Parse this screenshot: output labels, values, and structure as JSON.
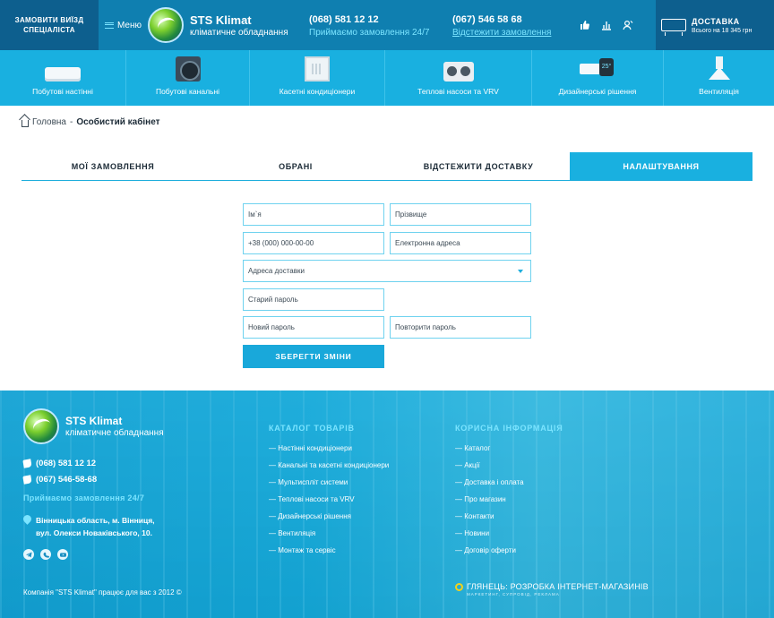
{
  "header": {
    "order_specialist": "ЗАМОВИТИ ВИЇЗД СПЕЦІАЛІСТА",
    "menu_label": "Меню",
    "brand_name": "STS Klimat",
    "brand_tagline": "кліматичне обладнання",
    "phone_1": "(068) 581 12 12",
    "phone_1_sub": "Приймаємо замовлення 24/7",
    "phone_2": "(067) 546 58 68",
    "phone_2_sub": "Відстежити замовлення",
    "icons": [
      "thumbs-up-icon",
      "chart-icon",
      "user-icon"
    ],
    "delivery_title": "ДОСТАВКА",
    "delivery_sub": "Всього на 18 345 грн"
  },
  "categories": [
    {
      "label": "Побутові настінні",
      "icon": "wall-ac-icon"
    },
    {
      "label": "Побутові канальні",
      "icon": "duct-ac-icon"
    },
    {
      "label": "Касетні кондиціонери",
      "icon": "cassette-ac-icon"
    },
    {
      "label": "Теплові насоси та VRV",
      "icon": "heat-pump-icon"
    },
    {
      "label": "Дизайнерські рішення",
      "icon": "designer-ac-icon",
      "badge": "25°"
    },
    {
      "label": "Вентиляція",
      "icon": "ventilation-icon"
    }
  ],
  "breadcrumb": {
    "home": "Головна",
    "separator": "-",
    "current": "Особистий кабінет"
  },
  "tabs": [
    {
      "label": "МОЇ ЗАМОВЛЕННЯ",
      "active": false
    },
    {
      "label": "ОБРАНІ",
      "active": false
    },
    {
      "label": "ВІДСТЕЖИТИ ДОСТАВКУ",
      "active": false
    },
    {
      "label": "НАЛАШТУВАННЯ",
      "active": true
    }
  ],
  "form": {
    "first_name_placeholder": "Ім`я",
    "last_name_placeholder": "Прізвище",
    "phone_placeholder": "+38 (000) 000-00-00",
    "email_placeholder": "Електронна адреса",
    "address_placeholder": "Адреса доставки",
    "old_password_placeholder": "Старий пароль",
    "new_password_placeholder": "Новий пароль",
    "repeat_password_placeholder": "Повторити пароль",
    "save_label": "ЗБЕРЕГТИ ЗМІНИ"
  },
  "footer": {
    "brand_name": "STS Klimat",
    "brand_tagline": "кліматичне обладнання",
    "phone_1": "(068) 581 12 12",
    "phone_2": "(067) 546-58-68",
    "accept_text": "Приймаємо замовлення 24/7",
    "address_line_1": "Вінницька область, м. Вінниця,",
    "address_line_2": "вул. Олекси Новаківського, 10.",
    "socials": [
      "telegram-icon",
      "viber-icon",
      "youtube-icon"
    ],
    "catalog_title": "КАТАЛОГ ТОВАРІВ",
    "catalog_items": [
      "— Настінні кондиціонери",
      "— Канальні та касетні кондиціонери",
      "— Мультиспліт системи",
      "— Теплові насоси та VRV",
      "— Дизайнерські рішення",
      "— Вентиляція",
      "— Монтаж та сервіс"
    ],
    "info_title": "КОРИСНА ІНФОРМАЦІЯ",
    "info_items": [
      "— Каталог",
      "— Акції",
      "— Доставка і оплата",
      "— Про магазин",
      "— Контакти",
      "— Новини",
      "— Договір оферти"
    ],
    "copyright": "Компанія \"STS Klimat\" працює для вас з 2012 ©",
    "developer": "ГЛЯНЕЦЬ: РОЗРОБКА ІНТЕРНЕТ-МАГАЗИНІВ",
    "developer_sub": "МАРКЕТИНГ, СУПРОВІД, РЕКЛАМА"
  },
  "colors": {
    "header_dark": "#0d5f8e",
    "header": "#0f7fb0",
    "accent": "#19b0e0",
    "accent_light": "#7be4ff"
  }
}
